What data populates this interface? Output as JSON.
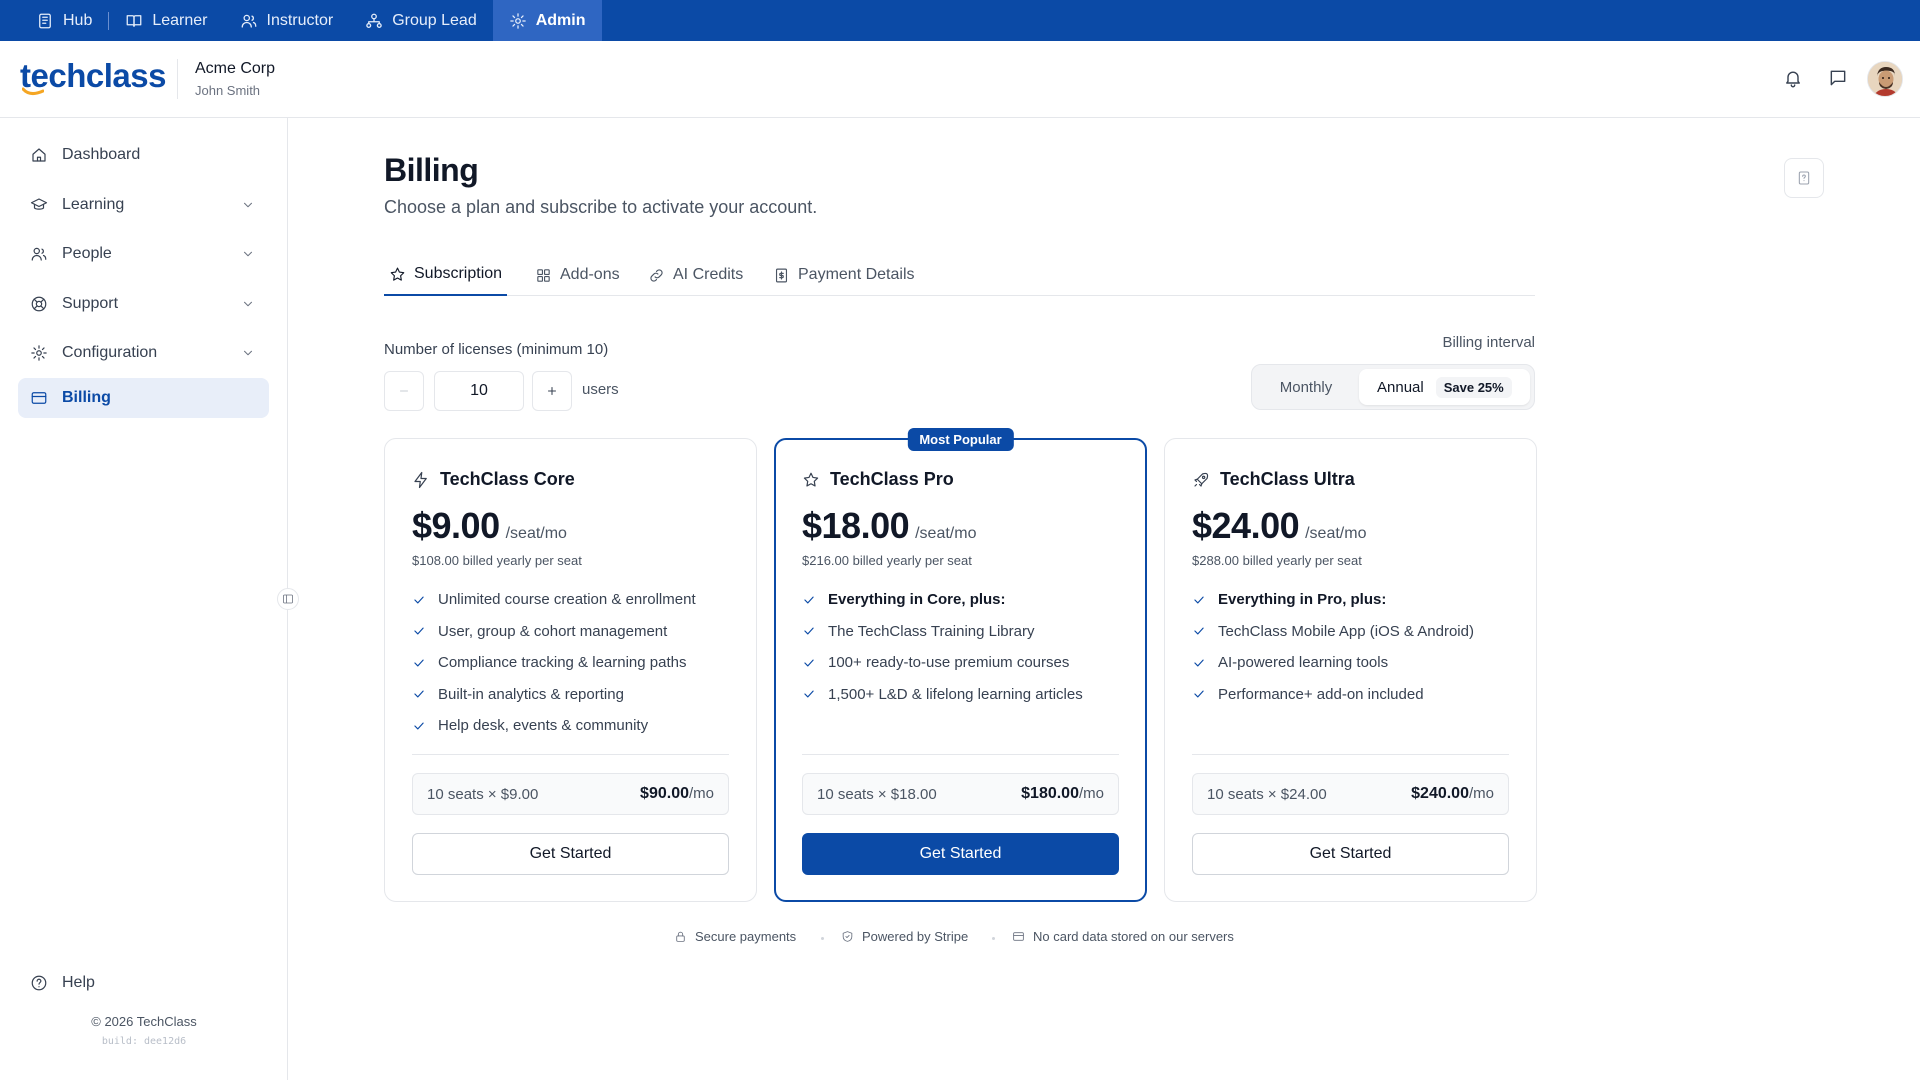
{
  "roles": [
    {
      "label": "Hub",
      "icon": "hub-icon",
      "active": false
    },
    {
      "label": "Learner",
      "icon": "book-icon",
      "active": false
    },
    {
      "label": "Instructor",
      "icon": "users-icon",
      "active": false
    },
    {
      "label": "Group Lead",
      "icon": "hierarchy-icon",
      "active": false
    },
    {
      "label": "Admin",
      "icon": "gear-icon",
      "active": true
    }
  ],
  "header": {
    "logo_text": "techclass",
    "org_name": "Acme Corp",
    "user_name": "John Smith"
  },
  "sidebar": {
    "items": [
      {
        "label": "Dashboard",
        "icon": "home-icon",
        "expandable": false,
        "active": false
      },
      {
        "label": "Learning",
        "icon": "graduation-cap-icon",
        "expandable": true,
        "active": false
      },
      {
        "label": "People",
        "icon": "people-icon",
        "expandable": true,
        "active": false
      },
      {
        "label": "Support",
        "icon": "lifebuoy-icon",
        "expandable": true,
        "active": false
      },
      {
        "label": "Configuration",
        "icon": "gear-icon",
        "expandable": true,
        "active": false
      },
      {
        "label": "Billing",
        "icon": "credit-card-icon",
        "expandable": false,
        "active": true
      }
    ],
    "help_label": "Help",
    "copyright": "© 2026 TechClass",
    "build": "build: dee12d6"
  },
  "page": {
    "title": "Billing",
    "subtitle": "Choose a plan and subscribe to activate your account."
  },
  "tabs": [
    {
      "label": "Subscription",
      "icon": "star-icon",
      "active": true
    },
    {
      "label": "Add-ons",
      "icon": "grid-icon",
      "active": false
    },
    {
      "label": "AI Credits",
      "icon": "link-icon",
      "active": false
    },
    {
      "label": "Payment Details",
      "icon": "receipt-icon",
      "active": false
    }
  ],
  "licenses": {
    "label": "Number of licenses (minimum 10)",
    "value": "10",
    "unit": "users"
  },
  "interval": {
    "label": "Billing interval",
    "monthly": "Monthly",
    "annual": "Annual",
    "save_badge": "Save 25%",
    "selected": "annual"
  },
  "plans": [
    {
      "name": "TechClass Core",
      "icon": "bolt-icon",
      "price": "$9.00",
      "per": "/seat/mo",
      "billed": "$108.00 billed yearly per seat",
      "featured": false,
      "features": [
        {
          "text": "Unlimited course creation & enrollment",
          "strong": false
        },
        {
          "text": "User, group & cohort management",
          "strong": false
        },
        {
          "text": "Compliance tracking & learning paths",
          "strong": false
        },
        {
          "text": "Built-in analytics & reporting",
          "strong": false
        },
        {
          "text": "Help desk, events & community",
          "strong": false
        }
      ],
      "formula": "10 seats × $9.00",
      "total": "$90.00",
      "total_unit": "/mo",
      "cta": "Get Started"
    },
    {
      "name": "TechClass Pro",
      "icon": "star-icon",
      "price": "$18.00",
      "per": "/seat/mo",
      "billed": "$216.00 billed yearly per seat",
      "featured": true,
      "badge": "Most Popular",
      "features": [
        {
          "text": "Everything in Core, plus:",
          "strong": true
        },
        {
          "text": "The TechClass Training Library",
          "strong": false
        },
        {
          "text": "100+ ready-to-use premium courses",
          "strong": false
        },
        {
          "text": "1,500+ L&D & lifelong learning articles",
          "strong": false
        }
      ],
      "formula": "10 seats × $18.00",
      "total": "$180.00",
      "total_unit": "/mo",
      "cta": "Get Started"
    },
    {
      "name": "TechClass Ultra",
      "icon": "rocket-icon",
      "price": "$24.00",
      "per": "/seat/mo",
      "billed": "$288.00 billed yearly per seat",
      "featured": false,
      "features": [
        {
          "text": "Everything in Pro, plus:",
          "strong": true
        },
        {
          "text": "TechClass Mobile App (iOS & Android)",
          "strong": false
        },
        {
          "text": "AI-powered learning tools",
          "strong": false
        },
        {
          "text": "Performance+ add-on included",
          "strong": false
        }
      ],
      "formula": "10 seats × $24.00",
      "total": "$240.00",
      "total_unit": "/mo",
      "cta": "Get Started"
    }
  ],
  "trust": [
    {
      "label": "Secure payments",
      "icon": "lock-icon"
    },
    {
      "label": "Powered by Stripe",
      "icon": "shield-check-icon"
    },
    {
      "label": "No card data stored on our servers",
      "icon": "card-icon"
    }
  ],
  "colors": {
    "brand": "#0b4aa6",
    "brand_light": "#2f66c2",
    "active_nav_bg": "#e8eef9",
    "border": "#e5e7eb"
  }
}
